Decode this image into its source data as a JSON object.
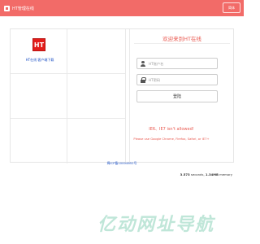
{
  "header": {
    "brand": "HT管理在线",
    "lang_label": "简体"
  },
  "brand_panel": {
    "logo_text": "HT",
    "caption": "HT在线 客户端下载"
  },
  "login": {
    "welcome": "欢迎来到HT在线",
    "username_placeholder": "HT账户名",
    "password_placeholder": "HT密码",
    "submit_label": "登陆"
  },
  "browser_warning": {
    "title": "IE6、IE7 isn't allowed!",
    "message": "Please use Google Chrome, Firefox, Safari, or IE7+"
  },
  "icp_link": "闽ICP备10004652号",
  "stats": {
    "seconds_value": "3.573",
    "seconds_label": "seconds",
    "memory_value": "1.34MB",
    "memory_label": "memory"
  },
  "watermark": [
    "亿",
    "动",
    "网",
    "址",
    "导",
    "航"
  ]
}
